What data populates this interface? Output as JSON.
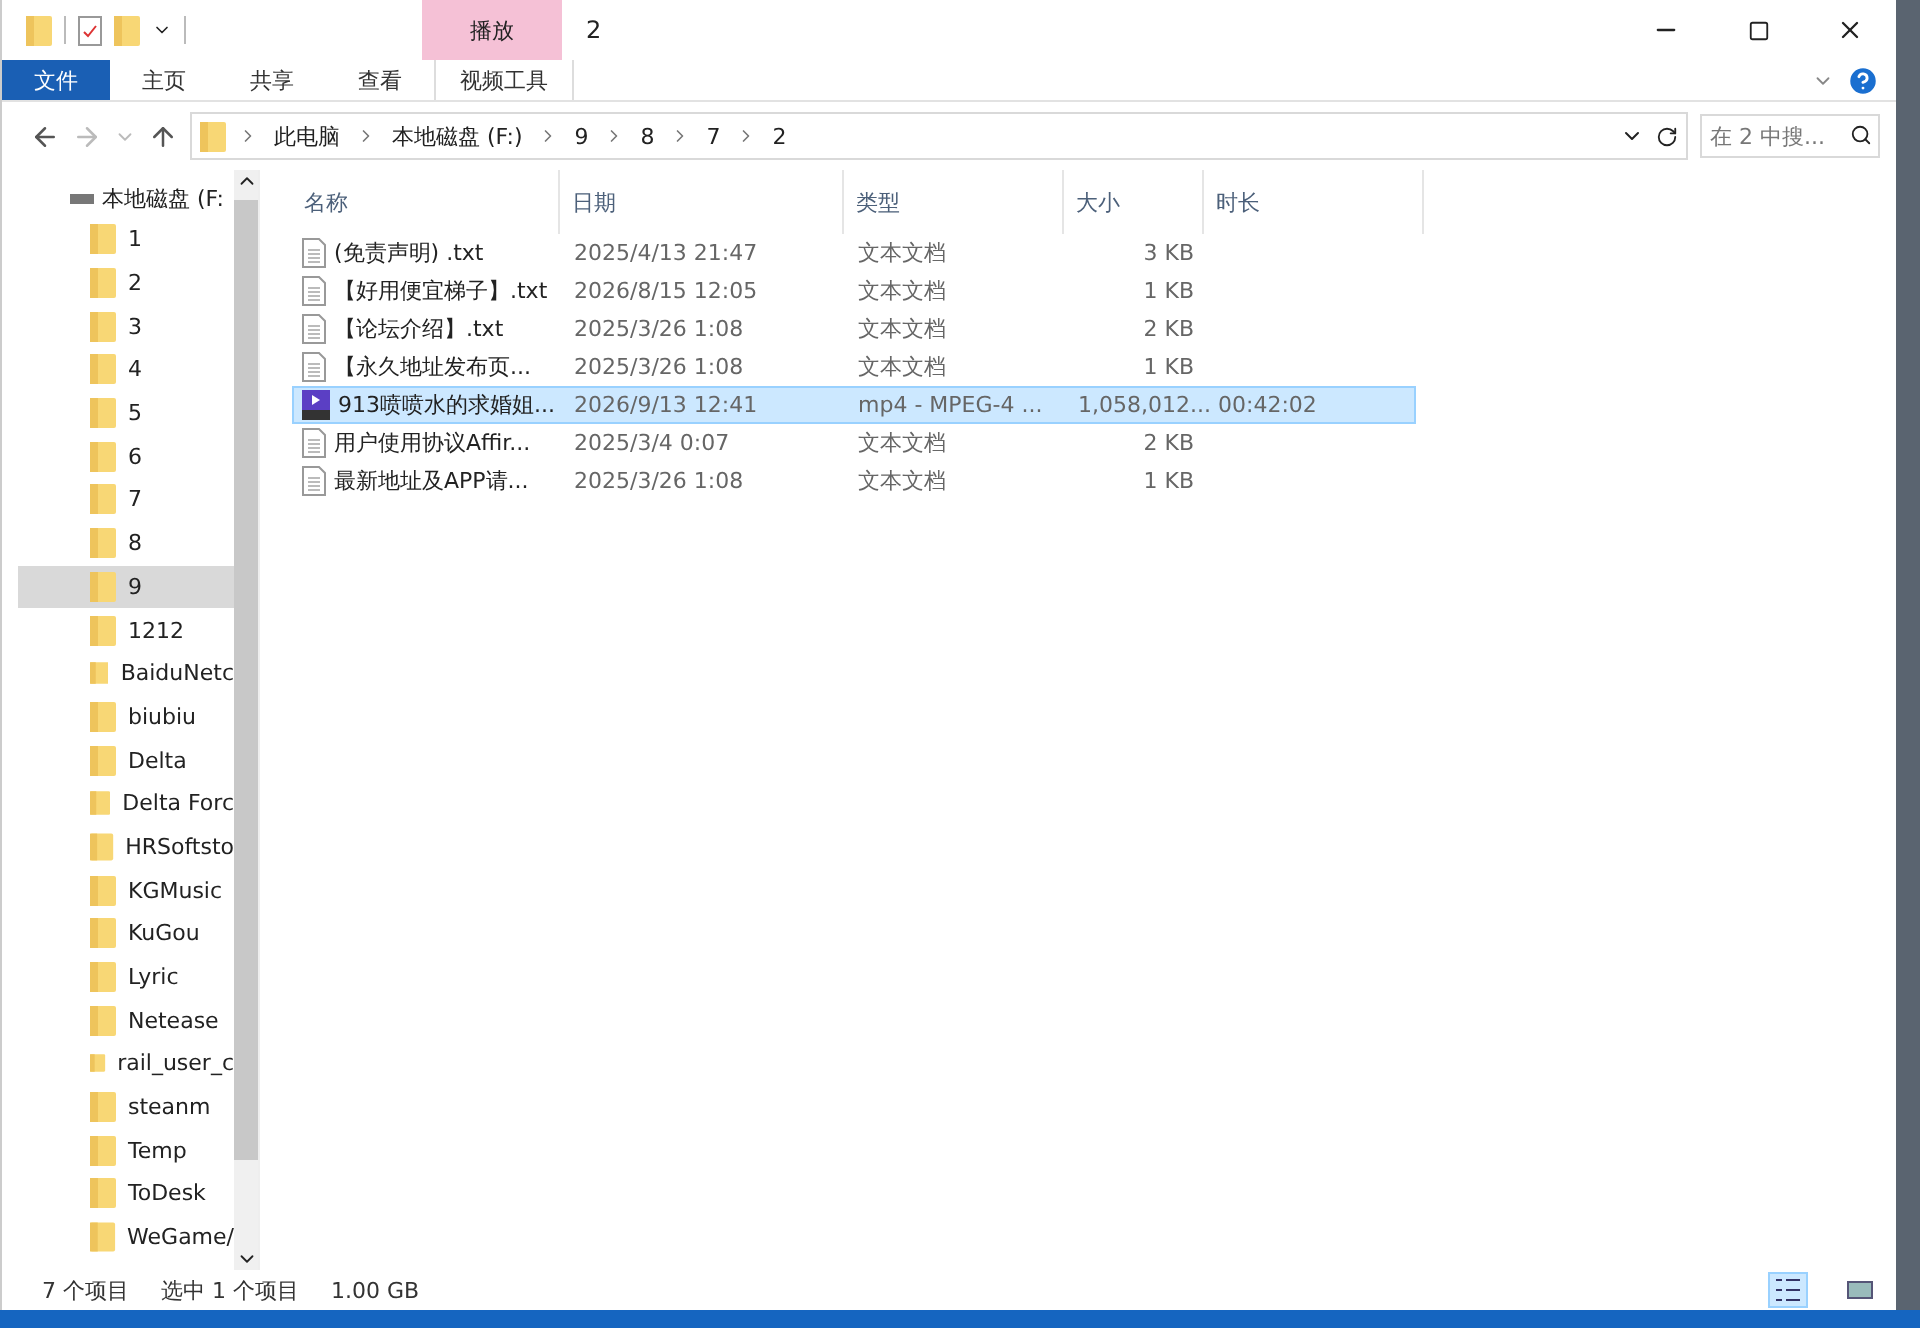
{
  "window": {
    "title": "2",
    "context_tab": "播放"
  },
  "ribbon_tabs": [
    {
      "label": "文件",
      "kind": "file",
      "selected": false
    },
    {
      "label": "主页",
      "kind": "tab",
      "selected": false
    },
    {
      "label": "共享",
      "kind": "tab",
      "selected": false
    },
    {
      "label": "查看",
      "kind": "tab",
      "selected": false
    },
    {
      "label": "视频工具",
      "kind": "context",
      "selected": false
    }
  ],
  "address": {
    "crumbs": [
      "此电脑",
      "本地磁盘 (F:)",
      "9",
      "8",
      "7",
      "2"
    ]
  },
  "search": {
    "placeholder": "在 2 中搜..."
  },
  "sidebar": {
    "root": "本地磁盘 (F:",
    "items": [
      {
        "label": "1",
        "selected": false
      },
      {
        "label": "2",
        "selected": false
      },
      {
        "label": "3",
        "selected": false
      },
      {
        "label": "4",
        "selected": false
      },
      {
        "label": "5",
        "selected": false
      },
      {
        "label": "6",
        "selected": false
      },
      {
        "label": "7",
        "selected": false
      },
      {
        "label": "8",
        "selected": false
      },
      {
        "label": "9",
        "selected": true
      },
      {
        "label": "1212",
        "selected": false
      },
      {
        "label": "BaiduNetc",
        "selected": false
      },
      {
        "label": "biubiu",
        "selected": false
      },
      {
        "label": "Delta",
        "selected": false
      },
      {
        "label": "Delta Forc",
        "selected": false
      },
      {
        "label": "HRSoftsto",
        "selected": false
      },
      {
        "label": "KGMusic",
        "selected": false
      },
      {
        "label": "KuGou",
        "selected": false
      },
      {
        "label": "Lyric",
        "selected": false
      },
      {
        "label": "Netease",
        "selected": false
      },
      {
        "label": "rail_user_c",
        "selected": false
      },
      {
        "label": "steanm",
        "selected": false
      },
      {
        "label": "Temp",
        "selected": false
      },
      {
        "label": "ToDesk",
        "selected": false
      },
      {
        "label": "WeGame/",
        "selected": false
      }
    ]
  },
  "table": {
    "columns": [
      "名称",
      "日期",
      "类型",
      "大小",
      "时长"
    ],
    "rows": [
      {
        "kind": "text",
        "name": "(免责声明) .txt",
        "date": "2025/4/13 21:47",
        "type": "文本文档",
        "size": "3 KB",
        "selected": false
      },
      {
        "kind": "text",
        "name": "【好用便宜梯子】.txt",
        "date": "2026/8/15 12:05",
        "type": "文本文档",
        "size": "1 KB",
        "selected": false
      },
      {
        "kind": "text",
        "name": "【论坛介绍】.txt",
        "date": "2025/3/26 1:08",
        "type": "文本文档",
        "size": "2 KB",
        "selected": false
      },
      {
        "kind": "text",
        "name": "【永久地址发布页...",
        "date": "2025/3/26 1:08",
        "type": "文本文档",
        "size": "1 KB",
        "selected": false
      },
      {
        "kind": "video",
        "name": "913喷喷水的求婚姐...",
        "date": "2026/9/13 12:41",
        "type": "mp4 - MPEG-4 ...",
        "size": "1,058,012...",
        "duration": "00:42:02",
        "selected": true
      },
      {
        "kind": "text",
        "name": "用户使用协议Affir...",
        "date": "2025/3/4 0:07",
        "type": "文本文档",
        "size": "2 KB",
        "selected": false
      },
      {
        "kind": "text",
        "name": "最新地址及APP请...",
        "date": "2025/3/26 1:08",
        "type": "文本文档",
        "size": "1 KB",
        "selected": false
      }
    ]
  },
  "status_bar": {
    "count": "7 个项目",
    "selection": "选中 1 个项目",
    "size": "1.00 GB"
  },
  "view_buttons": [
    {
      "kind": "details",
      "selected": true
    },
    {
      "kind": "thumbnails",
      "selected": false
    }
  ]
}
